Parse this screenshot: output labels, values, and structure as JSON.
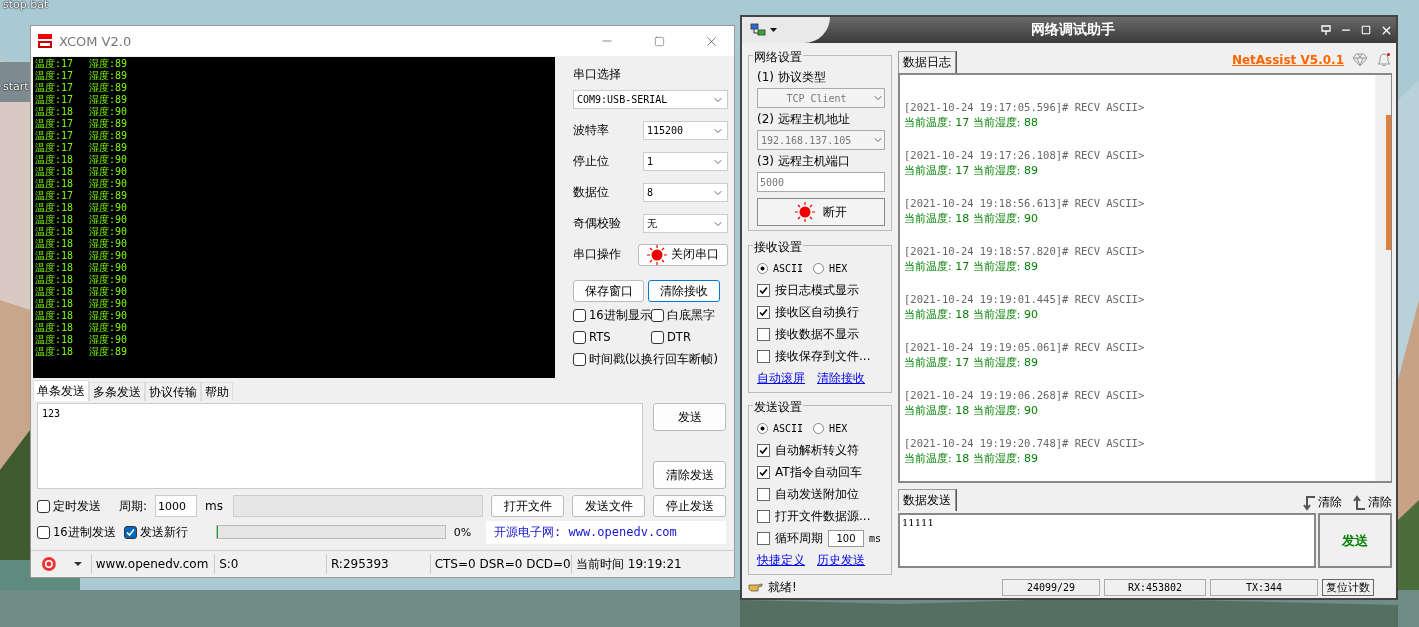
{
  "desktop": {
    "icons": [
      {
        "label": "stop.bat"
      },
      {
        "label": "start"
      }
    ]
  },
  "xcom": {
    "title": "XCOM V2.0",
    "receive_lines": [
      {
        "temp": "温度:17",
        "humid": "湿度:89"
      },
      {
        "temp": "温度:17",
        "humid": "湿度:89"
      },
      {
        "temp": "温度:17",
        "humid": "湿度:89"
      },
      {
        "temp": "温度:17",
        "humid": "湿度:89"
      },
      {
        "temp": "温度:18",
        "humid": "湿度:90"
      },
      {
        "temp": "温度:17",
        "humid": "湿度:89"
      },
      {
        "temp": "温度:17",
        "humid": "湿度:89"
      },
      {
        "temp": "温度:17",
        "humid": "湿度:89"
      },
      {
        "temp": "温度:18",
        "humid": "湿度:90"
      },
      {
        "temp": "温度:18",
        "humid": "湿度:90"
      },
      {
        "temp": "温度:18",
        "humid": "湿度:90"
      },
      {
        "temp": "温度:17",
        "humid": "湿度:89"
      },
      {
        "temp": "温度:18",
        "humid": "湿度:90"
      },
      {
        "temp": "温度:18",
        "humid": "湿度:90"
      },
      {
        "temp": "温度:18",
        "humid": "湿度:90"
      },
      {
        "temp": "温度:18",
        "humid": "湿度:90"
      },
      {
        "temp": "温度:18",
        "humid": "湿度:90"
      },
      {
        "temp": "温度:18",
        "humid": "湿度:90"
      },
      {
        "temp": "温度:18",
        "humid": "湿度:90"
      },
      {
        "temp": "温度:18",
        "humid": "湿度:90"
      },
      {
        "temp": "温度:18",
        "humid": "湿度:90"
      },
      {
        "temp": "温度:18",
        "humid": "湿度:90"
      },
      {
        "temp": "温度:18",
        "humid": "湿度:90"
      },
      {
        "temp": "温度:18",
        "humid": "湿度:90"
      },
      {
        "temp": "温度:18",
        "humid": "湿度:89"
      }
    ],
    "port_label": "串口选择",
    "port": "COM9:USB-SERIAL",
    "settings": [
      {
        "label": "波特率",
        "value": "115200"
      },
      {
        "label": "停止位",
        "value": "1"
      },
      {
        "label": "数据位",
        "value": "8"
      },
      {
        "label": "奇偶校验",
        "value": "无"
      }
    ],
    "port_op": {
      "label": "串口操作",
      "button": "关闭串口",
      "open": true
    },
    "buttons": [
      "保存窗口",
      "清除接收"
    ],
    "options": [
      {
        "label": "16进制显示",
        "checked": false
      },
      {
        "label": "白底黑字",
        "checked": false
      },
      {
        "label": "RTS",
        "checked": false
      },
      {
        "label": "DTR",
        "checked": false
      },
      {
        "label": "时间戳(以换行回车断帧)",
        "checked": false
      }
    ],
    "tabs": [
      {
        "label": "单条发送",
        "selected": true
      },
      {
        "label": "多条发送",
        "selected": false
      },
      {
        "label": "协议传输",
        "selected": false
      },
      {
        "label": "帮助",
        "selected": false
      }
    ],
    "send_text": "123",
    "send_buttons": [
      "发送",
      "清除发送"
    ],
    "timed_send": {
      "label": "定时发送",
      "checked": false
    },
    "period_label": "周期:",
    "period": "1000",
    "period_unit": "ms",
    "file_buttons": [
      "打开文件",
      "发送文件",
      "停止发送"
    ],
    "hex_send": {
      "label": "16进制发送",
      "checked": false
    },
    "newline": {
      "label": "发送新行",
      "checked": true
    },
    "progress": {
      "level": 0,
      "reading": "0%"
    },
    "banner": "开源电子网: www.openedv.com",
    "status": [
      "www.openedv.com",
      "S:0",
      "R:295393",
      "CTS=0 DSR=0 DCD=0",
      "当前时间 19:19:21"
    ]
  },
  "netassist": {
    "title": "网络调试助手",
    "net_settings": {
      "title": "网络设置",
      "protocol_label": "(1) 协议类型",
      "protocol": "TCP Client",
      "host_label": "(2) 远程主机地址",
      "host": "192.168.137.105",
      "port_label": "(3) 远程主机端口",
      "port": "5000",
      "connect_button": "断开",
      "connected": true
    },
    "recv_settings": {
      "title": "接收设置",
      "encodings": [
        {
          "label": "ASCII",
          "selected": true
        },
        {
          "label": "HEX",
          "selected": false
        }
      ],
      "options": [
        {
          "label": "按日志模式显示",
          "checked": true
        },
        {
          "label": "接收区自动换行",
          "checked": true
        },
        {
          "label": "接收数据不显示",
          "checked": false
        },
        {
          "label": "接收保存到文件...",
          "checked": false
        }
      ],
      "links": [
        "自动滚屏",
        "清除接收"
      ]
    },
    "send_settings": {
      "title": "发送设置",
      "encodings": [
        {
          "label": "ASCII",
          "selected": true
        },
        {
          "label": "HEX",
          "selected": false
        }
      ],
      "options": [
        {
          "label": "自动解析转义符",
          "checked": true
        },
        {
          "label": "AT指令自动回车",
          "checked": true
        },
        {
          "label": "自动发送附加位",
          "checked": false
        },
        {
          "label": "打开文件数据源...",
          "checked": false
        },
        {
          "label": "循环周期",
          "checked": false,
          "value": "100",
          "unit": "ms"
        }
      ],
      "links": [
        "快捷定义",
        "历史发送"
      ]
    },
    "log_tab": "数据日志",
    "brand": "NetAssist V5.0.1",
    "log": [
      {
        "header": "[2021-10-24 19:17:05.596]# RECV ASCII>",
        "body": "当前温度: 17 当前湿度: 88"
      },
      {
        "header": "[2021-10-24 19:17:26.108]# RECV ASCII>",
        "body": "当前温度: 17 当前湿度: 89"
      },
      {
        "header": "[2021-10-24 19:18:56.613]# RECV ASCII>",
        "body": "当前温度: 18 当前湿度: 90"
      },
      {
        "header": "[2021-10-24 19:18:57.820]# RECV ASCII>",
        "body": "当前温度: 17 当前湿度: 89"
      },
      {
        "header": "[2021-10-24 19:19:01.445]# RECV ASCII>",
        "body": "当前温度: 18 当前湿度: 90"
      },
      {
        "header": "[2021-10-24 19:19:05.061]# RECV ASCII>",
        "body": "当前温度: 17 当前湿度: 89"
      },
      {
        "header": "[2021-10-24 19:19:06.268]# RECV ASCII>",
        "body": "当前温度: 18 当前湿度: 90"
      },
      {
        "header": "[2021-10-24 19:19:20.748]# RECV ASCII>",
        "body": "当前温度: 18 当前湿度: 89"
      }
    ],
    "send_tab": "数据发送",
    "clear_buttons": [
      "清除",
      "清除"
    ],
    "send_text": "11111",
    "send_button": "发送",
    "status": "就绪!",
    "counters": [
      "24099/29",
      "RX:453802",
      "TX:344"
    ],
    "reset_button": "复位计数"
  }
}
